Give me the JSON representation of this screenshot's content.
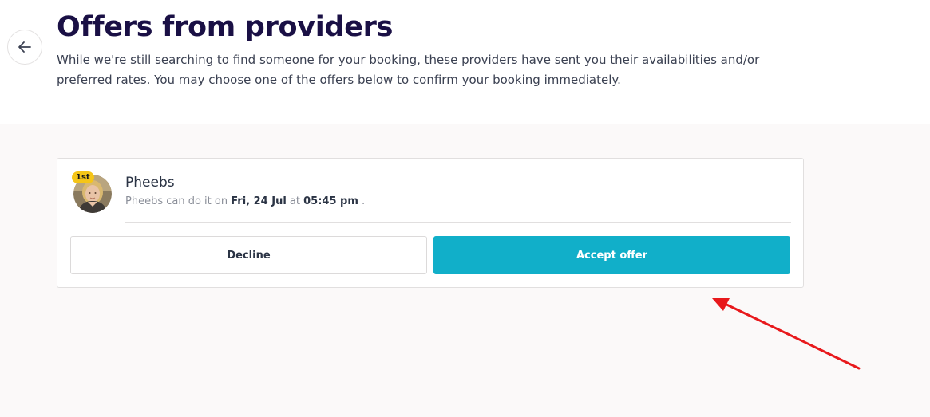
{
  "header": {
    "title": "Offers from providers",
    "description": "While we're still searching to find someone for your booking, these providers have sent you their availabilities and/or preferred rates. You may choose one of the offers below to confirm your booking immediately."
  },
  "offers": [
    {
      "rank_badge": "1st",
      "name": "Pheebs",
      "sub_prefix": "Pheebs can do it on ",
      "date": "Fri, 24 Jul",
      "sub_mid": " at ",
      "time": "05:45 pm",
      "sub_suffix": " .",
      "decline_label": "Decline",
      "accept_label": "Accept offer"
    }
  ],
  "colors": {
    "accent": "#11afc9",
    "title": "#1a1045",
    "badge": "#f5c518",
    "annotation": "#e8191c"
  },
  "icons": {
    "back": "arrow-left-icon"
  }
}
